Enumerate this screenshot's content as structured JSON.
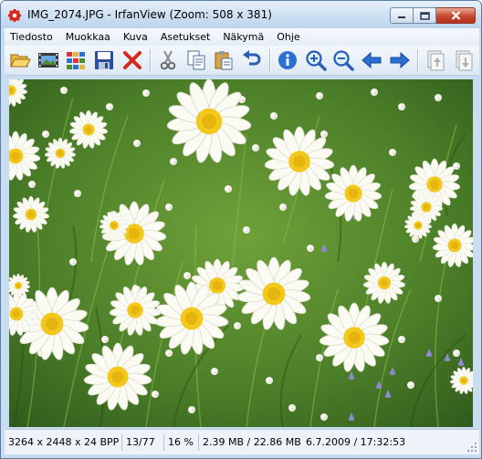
{
  "window": {
    "title": "IMG_2074.JPG - IrfanView (Zoom: 508 x 381)"
  },
  "menu": [
    {
      "label": "Tiedosto"
    },
    {
      "label": "Muokkaa"
    },
    {
      "label": "Kuva"
    },
    {
      "label": "Asetukset"
    },
    {
      "label": "Näkymä"
    },
    {
      "label": "Ohje"
    }
  ],
  "toolbar": {
    "buttons": [
      {
        "icon": "open-folder-icon"
      },
      {
        "icon": "slideshow-icon"
      },
      {
        "icon": "thumbnails-icon"
      },
      {
        "icon": "save-icon"
      },
      {
        "icon": "delete-icon"
      },
      {
        "icon": "cut-icon"
      },
      {
        "icon": "copy-icon"
      },
      {
        "icon": "paste-icon"
      },
      {
        "icon": "undo-icon"
      },
      {
        "icon": "info-icon"
      },
      {
        "icon": "zoom-in-icon"
      },
      {
        "icon": "zoom-out-icon"
      },
      {
        "icon": "previous-icon"
      },
      {
        "icon": "next-icon"
      },
      {
        "icon": "first-page-icon"
      },
      {
        "icon": "last-page-icon"
      }
    ]
  },
  "status": {
    "dimensions": "3264 x 2448 x 24 BPP",
    "position": "13/77",
    "zoom": "16 %",
    "size": "2.39 MB / 22.86 MB",
    "datetime": "6.7.2009 / 17:32:53"
  },
  "colors": {
    "accent": "#1f5fb5",
    "close_red": "#c8472e",
    "grass": "#4c7a2c"
  }
}
